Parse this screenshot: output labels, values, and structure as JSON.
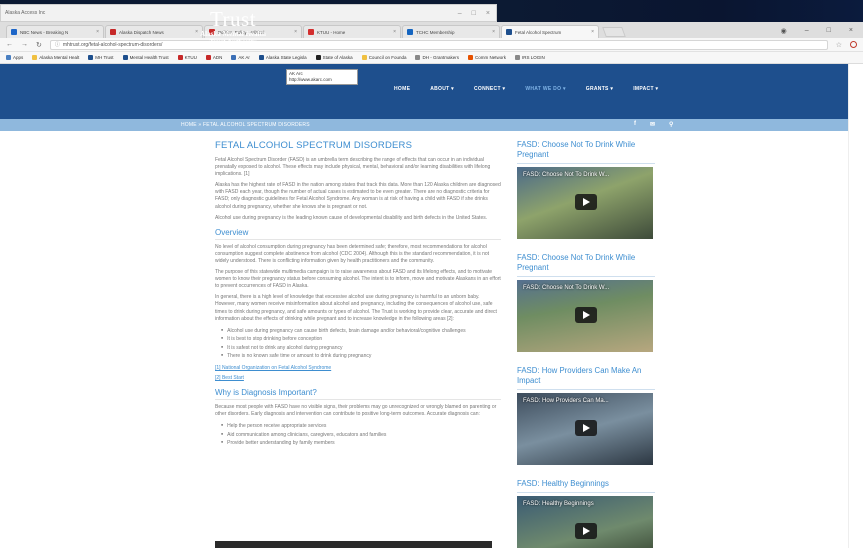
{
  "browser": {
    "mini_window_title": "Alaska Access Inc",
    "tabs": [
      {
        "label": "NBC News - Breaking N",
        "color": "#1e66c8",
        "active": false
      },
      {
        "label": "Alaska Dispatch News",
        "color": "#c62828",
        "active": false
      },
      {
        "label": "Politics, Policy, Political",
        "color": "#c62828",
        "active": false
      },
      {
        "label": "KTUU - Home",
        "color": "#d32f2f",
        "active": false
      },
      {
        "label": "TCHC Membership",
        "color": "#1565c0",
        "active": false
      },
      {
        "label": "Fetal Alcohol Spectrum",
        "color": "#1e4f8d",
        "active": true
      }
    ],
    "url": "mhtrust.org/fetal-alcohol-spectrum-disorders/",
    "bookmarks": [
      {
        "label": "Apps",
        "color": "#4a7fc1"
      },
      {
        "label": "Alaska Mental Healt",
        "color": "#f0c040"
      },
      {
        "label": "MH Trust",
        "color": "#1e4f8d"
      },
      {
        "label": "Mental Health Trust",
        "color": "#1e4f8d"
      },
      {
        "label": "KTUU",
        "color": "#c62828"
      },
      {
        "label": "ADN",
        "color": "#c62828"
      },
      {
        "label": "AK Ar",
        "color": "#3b6fb6"
      },
      {
        "label": "Alaska State Legisla",
        "color": "#1e4f8d"
      },
      {
        "label": "State of Alaska",
        "color": "#222222"
      },
      {
        "label": "Council on Founda",
        "color": "#f0c040"
      },
      {
        "label": "DH - Grantmakers",
        "color": "#888888"
      },
      {
        "label": "Comm Network",
        "color": "#e65100"
      },
      {
        "label": "IRS LOGIN",
        "color": "#888888"
      }
    ]
  },
  "site": {
    "logo_big": "Trust",
    "logo_sub1": "Alaska Mental Health",
    "logo_sub2": "Trust Authority",
    "tooltip_line1": "AK Arc",
    "tooltip_line2": "http://www.akarc.com",
    "nav": [
      "HOME",
      "ABOUT ▾",
      "CONNECT ▾",
      "WHAT WE DO ▾",
      "GRANTS ▾",
      "IMPACT ▾"
    ],
    "breadcrumb": "HOME » FETAL ALCOHOL SPECTRUM DISORDERS",
    "social": [
      "f",
      "✉",
      "⚲"
    ]
  },
  "article": {
    "title": "FETAL ALCOHOL SPECTRUM DISORDERS",
    "p1": "Fetal Alcohol Spectrum Disorder (FASD) is an umbrella term describing the range of effects that can occur in an individual prenatally exposed to alcohol. These effects may include physical, mental, behavioral and/or learning disabilities with lifelong implications. [1]",
    "p2": "Alaska has the highest rate of FASD in the nation among states that track this data. More than 120 Alaska children are diagnosed with FASD each year, though the number of actual cases is estimated to be even greater. There are no diagnostic criteria for FASD; only diagnostic guidelines for Fetal Alcohol Syndrome. Any woman is at risk of having a child with FASD if she drinks alcohol during pregnancy, whether she knows she is pregnant or not.",
    "p3": "Alcohol use during pregnancy is the leading known cause of developmental disability and birth defects in the United States.",
    "h_overview": "Overview",
    "p4": "No level of alcohol consumption during pregnancy has been determined safe; therefore, most recommendations for alcohol consumption suggest complete abstinence from alcohol (CDC 2004). Although this is the standard recommendation, it is not widely understood. There is conflicting information given by health practitioners and the community.",
    "p5": "The purpose of this statewide multimedia campaign is to raise awareness about FASD and its lifelong effects, and to motivate women to know their pregnancy status before consuming alcohol. The intent is to inform, move and motivate Alaskans in an effort to prevent occurrences of FASD in Alaska.",
    "p6": "In general, there is a high level of knowledge that excessive alcohol use during pregnancy is harmful to an unborn baby. However, many women receive misinformation about alcohol and pregnancy, including the consequences of alcohol use, safe times to drink during pregnancy, and safe amounts or types of alcohol. The Trust is working to provide clear, accurate and direct information about the effects of drinking while pregnant and to increase knowledge in the following areas [2]:",
    "list1": [
      "Alcohol use during pregnancy can cause birth defects, brain damage and/or behavioral/cognitive challenges",
      "It is best to stop drinking before conception",
      "It is safest not to drink any alcohol during pregnancy",
      "There is no known safe time or amount to drink during pregnancy"
    ],
    "ref1": "[1] National Organization on Fetal Alcohol Syndrome",
    "ref2": "[2] Best Start",
    "h_why": "Why is Diagnosis Important?",
    "p7": "Because most people with FASD have no visible signs, their problems may go unrecognized or wrongly blamed on parenting or other disorders. Early diagnosis and intervention can contribute to positive long-term outcomes. Accurate diagnosis can:",
    "list2": [
      "Help the person receive appropriate services",
      "Aid communication among clinicians, caregivers, educators and families",
      "Provide better understanding by family members"
    ]
  },
  "sidebar": [
    {
      "title": "FASD: Choose Not To Drink While Pregnant",
      "video_title": "FASD: Choose Not To Drink W..."
    },
    {
      "title": "FASD: Choose Not To Drink While Pregnant",
      "video_title": "FASD: Choose Not To Drink W..."
    },
    {
      "title": "FASD: How Providers Can Make An Impact",
      "video_title": "FASD: How Providers Can Ma..."
    },
    {
      "title": "FASD: Healthy Beginnings",
      "video_title": "FASD: Healthy Beginnings"
    }
  ]
}
